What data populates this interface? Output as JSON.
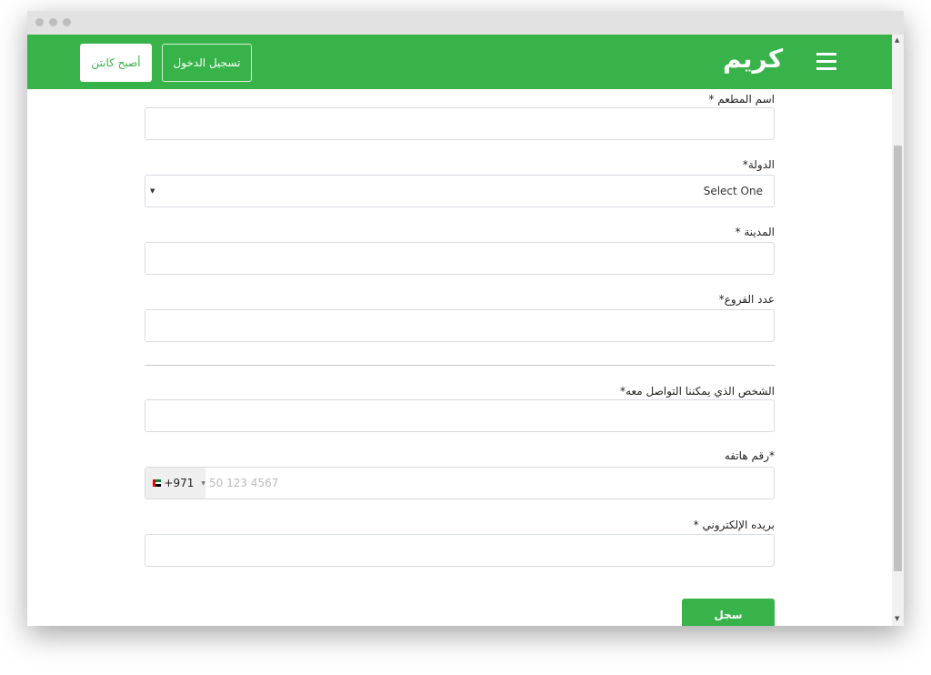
{
  "header": {
    "logo": "كريم",
    "login_label": "تسجيل الدخول",
    "captain_label": "أصبح كابتن"
  },
  "form": {
    "restaurant_name_label": "اسم المطعم *",
    "country_label": "الدولة*",
    "country_value": "Select One",
    "city_label": "المدينة *",
    "branches_label": "عدد الفروع*",
    "contact_label": "الشخص الذي يمكننا التواصل معه*",
    "phone_label": "*رقم هاتفه",
    "phone_code": "+971",
    "phone_placeholder": "50 123 4567",
    "email_label": "بريده الإلكتروني *",
    "submit_label": "سجل"
  },
  "colors": {
    "brand": "#37b34a"
  }
}
